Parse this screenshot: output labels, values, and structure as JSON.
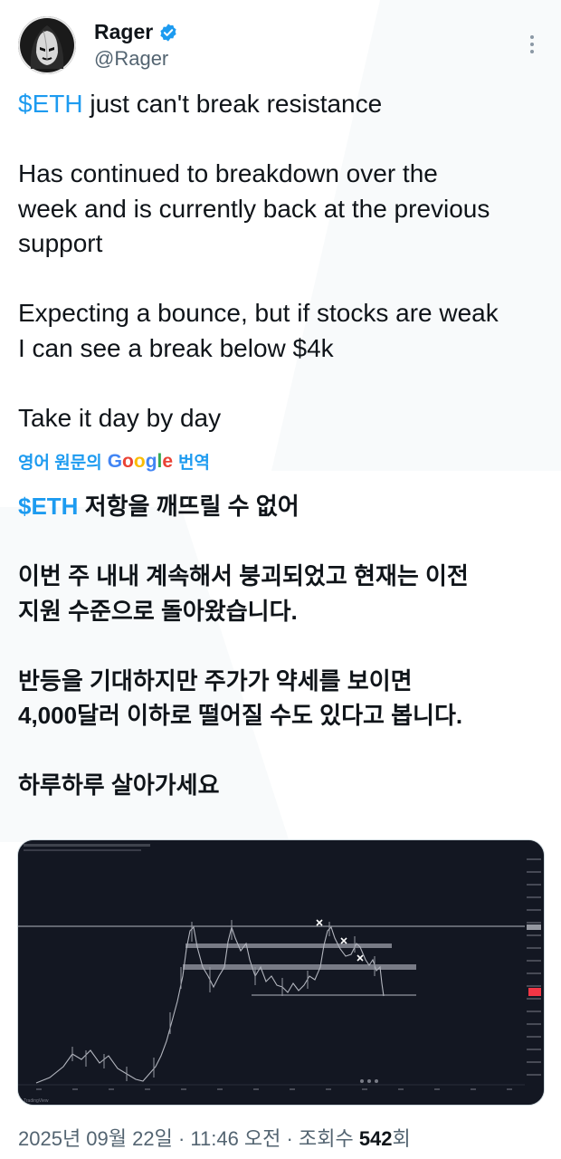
{
  "author": {
    "display_name": "Rager",
    "handle": "@Rager",
    "verified_icon": "verified-badge-icon",
    "avatar_icon": "masked-figure-avatar"
  },
  "tweet": {
    "line1_cashtag": "$ETH",
    "line1_rest": " just can't break resistance",
    "para2": "Has continued to breakdown over the\nweek and is currently back at the previous\nsupport",
    "para3": "Expecting a bounce, but if stocks are weak\nI can see a break below $4k",
    "para4": "Take it day by day"
  },
  "translation": {
    "prefix": "영어 원문의",
    "google_letters": [
      "G",
      "o",
      "o",
      "g",
      "l",
      "e"
    ],
    "suffix": "번역"
  },
  "translated": {
    "line1_cashtag": "$ETH",
    "line1_rest": " 저항을 깨뜨릴 수 없어",
    "para2": "이번 주 내내 계속해서 붕괴되었고 현재는 이전\n지원 수준으로 돌아왔습니다.",
    "para3": "반등을 기대하지만 주가가 약세를 보이면\n4,000달러 이하로 떨어질 수도 있다고 봅니다.",
    "para4": "하루하루 살아가세요"
  },
  "media": {
    "watermark": "TradingView",
    "chart_image": "ETH price chart with resistance and support levels"
  },
  "footer": {
    "date": "2025년 09월 22일",
    "sep1": " · ",
    "time": "11:46 오전",
    "sep2": " · ",
    "views_label": "조회수 ",
    "views_count": "542",
    "views_unit": "회"
  },
  "colors": {
    "accent": "#1d9bf0",
    "text": "#0f1419",
    "muted": "#536471",
    "chart_bg": "#131722"
  }
}
